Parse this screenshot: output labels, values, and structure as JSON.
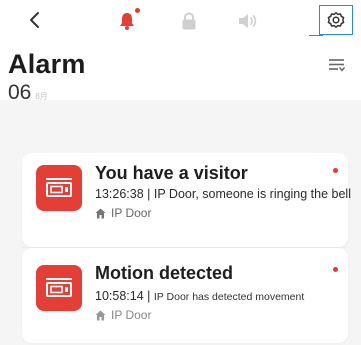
{
  "toolbar": {
    "back_icon": "chevron-left-icon",
    "bell_icon": "bell-icon",
    "lock_icon": "lock-icon",
    "speaker_icon": "speaker-icon",
    "settings_icon": "gear-icon"
  },
  "colors": {
    "accent_red": "#e43f37",
    "selected_blue": "#2a8ad8",
    "inactive_icon": "#cfcfcf"
  },
  "header": {
    "title": "Alarm",
    "filter_icon": "filter-list-icon"
  },
  "date": {
    "day": "06",
    "month": "8月"
  },
  "alarms": [
    {
      "title": "You have a visitor",
      "time": "13:26:38",
      "separator": " | ",
      "description": "IP Door, someone is ringing the bell",
      "source": "IP Door",
      "unread": true
    },
    {
      "title": "Motion detected",
      "time": "10:58:14",
      "separator": " | ",
      "description": "IP Door has detected movement",
      "source": "IP Door",
      "unread": true
    }
  ]
}
